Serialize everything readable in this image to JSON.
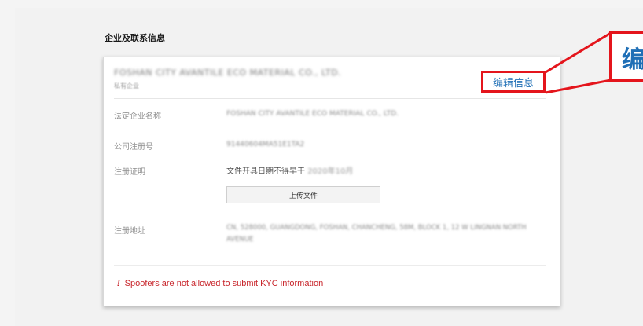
{
  "section": {
    "title": "企业及联系信息"
  },
  "company": {
    "name": "FOSHAN CITY AVANTILE ECO MATERIAL CO., LTD.",
    "type": "私有企业"
  },
  "edit": {
    "label": "编辑信息",
    "zoom_char": "编"
  },
  "fields": {
    "legal_name": {
      "label": "法定企业名称",
      "value": "FOSHAN CITY AVANTILE ECO MATERIAL CO., LTD."
    },
    "reg_number": {
      "label": "公司注册号",
      "value": "91440604MA51E1TA2"
    },
    "reg_proof": {
      "label": "注册证明",
      "note_prefix": "文件开具日期不得早于",
      "note_date": "2020年10月"
    },
    "address": {
      "label": "注册地址",
      "line1": "CN, 528000, GUANGDONG, FOSHAN, CHANCHENG, 58M, BLOCK 1, 12 W LINGNAN NORTH",
      "line2": "AVENUE"
    }
  },
  "upload": {
    "label": "上传文件"
  },
  "warning": {
    "mark": "!",
    "text": "Spoofers are not allowed to submit KYC information"
  },
  "colors": {
    "highlight": "#e4151c",
    "link": "#1f6fb6",
    "warning": "#c8252b"
  }
}
